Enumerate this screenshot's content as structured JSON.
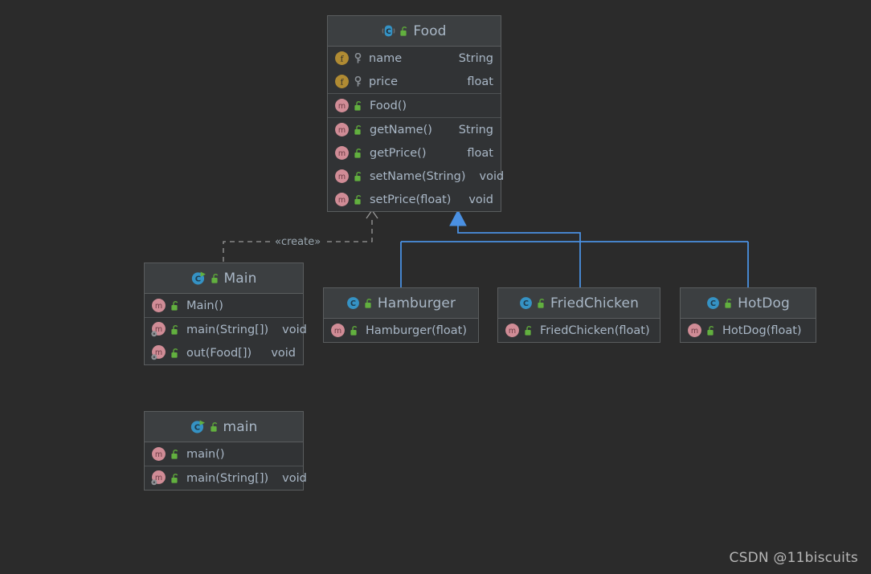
{
  "canvas": {
    "background": "#2b2b2b",
    "node_background": "#313335",
    "node_header_background": "#3c3f41",
    "node_border": "#5a5d5e",
    "text_color": "#a9b7c6",
    "inheritance_color": "#4a90e2",
    "dependency_color": "#9a9a9a"
  },
  "icons": {
    "class": "class-icon",
    "runnable_class": "runnable-class-icon",
    "field": "field-icon",
    "method": "method-icon",
    "static_method": "static-method-icon",
    "public": "unlock-icon",
    "private": "key-icon"
  },
  "nodes": [
    {
      "id": "food",
      "name": "Food",
      "header_icon": "class-icon",
      "visibility_icon": "unlock-icon",
      "sections": [
        {
          "members": [
            {
              "icon": "field-icon",
              "visibility": "key-icon",
              "name": "name",
              "type": "String"
            },
            {
              "icon": "field-icon",
              "visibility": "key-icon",
              "name": "price",
              "type": "float"
            }
          ]
        },
        {
          "members": [
            {
              "icon": "method-icon",
              "visibility": "unlock-icon",
              "name": "Food()",
              "type": ""
            }
          ]
        },
        {
          "members": [
            {
              "icon": "method-icon",
              "visibility": "unlock-icon",
              "name": "getName()",
              "type": "String"
            },
            {
              "icon": "method-icon",
              "visibility": "unlock-icon",
              "name": "getPrice()",
              "type": "float"
            },
            {
              "icon": "method-icon",
              "visibility": "unlock-icon",
              "name": "setName(String)",
              "type": "void"
            },
            {
              "icon": "method-icon",
              "visibility": "unlock-icon",
              "name": "setPrice(float)",
              "type": "void"
            }
          ]
        }
      ]
    },
    {
      "id": "main-class",
      "name": "Main",
      "header_icon": "runnable-class-icon",
      "visibility_icon": "unlock-icon",
      "sections": [
        {
          "members": [
            {
              "icon": "method-icon",
              "visibility": "unlock-icon",
              "name": "Main()",
              "type": ""
            }
          ]
        },
        {
          "members": [
            {
              "icon": "static-method-icon",
              "visibility": "unlock-icon",
              "name": "main(String[])",
              "type": "void"
            },
            {
              "icon": "static-method-icon",
              "visibility": "unlock-icon",
              "name": "out(Food[])",
              "type": "void"
            }
          ]
        }
      ]
    },
    {
      "id": "main-lower",
      "name": "main",
      "header_icon": "runnable-class-icon",
      "visibility_icon": "unlock-icon",
      "sections": [
        {
          "members": [
            {
              "icon": "method-icon",
              "visibility": "unlock-icon",
              "name": "main()",
              "type": ""
            }
          ]
        },
        {
          "members": [
            {
              "icon": "static-method-icon",
              "visibility": "unlock-icon",
              "name": "main(String[])",
              "type": "void"
            }
          ]
        }
      ]
    },
    {
      "id": "hamburger",
      "name": "Hamburger",
      "header_icon": "class-icon",
      "visibility_icon": "unlock-icon",
      "sections": [
        {
          "members": [
            {
              "icon": "method-icon",
              "visibility": "unlock-icon",
              "name": "Hamburger(float)",
              "type": ""
            }
          ]
        }
      ]
    },
    {
      "id": "friedchicken",
      "name": "FriedChicken",
      "header_icon": "class-icon",
      "visibility_icon": "unlock-icon",
      "sections": [
        {
          "members": [
            {
              "icon": "method-icon",
              "visibility": "unlock-icon",
              "name": "FriedChicken(float)",
              "type": ""
            }
          ]
        }
      ]
    },
    {
      "id": "hotdog",
      "name": "HotDog",
      "header_icon": "class-icon",
      "visibility_icon": "unlock-icon",
      "sections": [
        {
          "members": [
            {
              "icon": "method-icon",
              "visibility": "unlock-icon",
              "name": "HotDog(float)",
              "type": ""
            }
          ]
        }
      ]
    }
  ],
  "edges": [
    {
      "id": "create-edge",
      "from": "main-class",
      "to": "food",
      "kind": "dependency",
      "label": "«create»"
    },
    {
      "id": "hamburger-edge",
      "from": "hamburger",
      "to": "food",
      "kind": "generalization",
      "label": ""
    },
    {
      "id": "friedchicken-edge",
      "from": "friedchicken",
      "to": "food",
      "kind": "generalization",
      "label": ""
    },
    {
      "id": "hotdog-edge",
      "from": "hotdog",
      "to": "food",
      "kind": "generalization",
      "label": ""
    }
  ],
  "watermark": {
    "text": "CSDN @11biscuits"
  }
}
